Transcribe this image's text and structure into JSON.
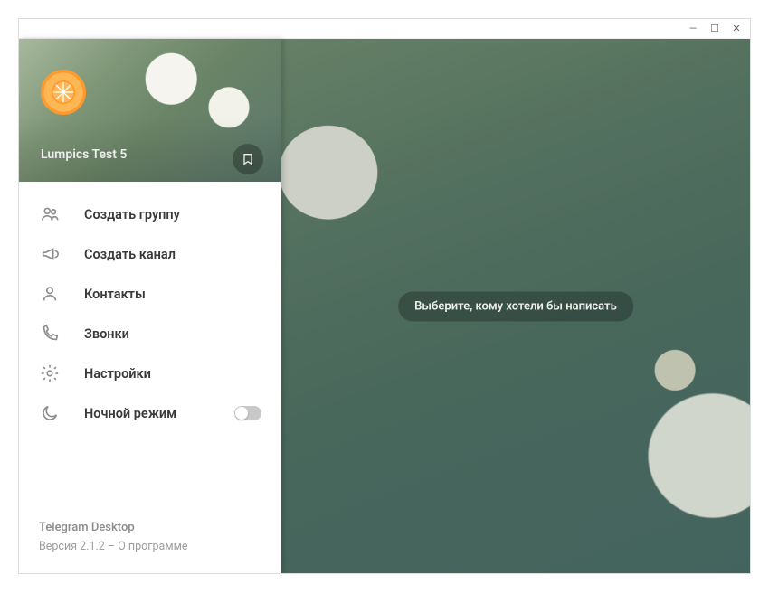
{
  "window": {
    "min_icon": "—",
    "max_icon": "☐",
    "close_icon": "✕"
  },
  "profile": {
    "username": "Lumpics Test 5",
    "avatar_name": "orange-avatar"
  },
  "saved_button": {
    "name": "saved-messages"
  },
  "menu": {
    "items": [
      {
        "key": "new-group",
        "icon": "people-icon",
        "label": "Создать группу"
      },
      {
        "key": "new-channel",
        "icon": "megaphone-icon",
        "label": "Создать канал"
      },
      {
        "key": "contacts",
        "icon": "user-icon",
        "label": "Контакты"
      },
      {
        "key": "calls",
        "icon": "phone-icon",
        "label": "Звонки"
      },
      {
        "key": "settings",
        "icon": "gear-icon",
        "label": "Настройки"
      },
      {
        "key": "night-mode",
        "icon": "moon-icon",
        "label": "Ночной режим",
        "toggle": false
      }
    ]
  },
  "footer": {
    "app_name": "Telegram Desktop",
    "version_line": "Версия 2.1.2 – О программе"
  },
  "main": {
    "hint": "Выберите, кому хотели бы написать"
  }
}
